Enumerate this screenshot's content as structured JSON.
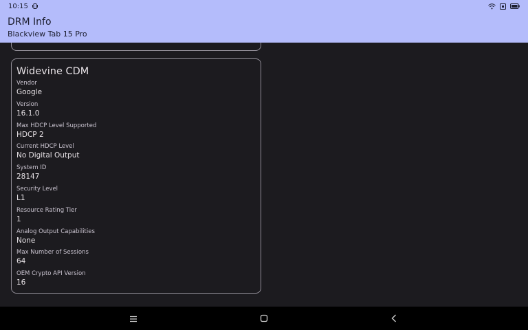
{
  "status_bar": {
    "time": "10:15",
    "icons": [
      "vibrate-icon",
      "wifi-icon",
      "sim-icon",
      "battery-icon"
    ]
  },
  "app_bar": {
    "title": "DRM Info",
    "subtitle": "Blackview Tab 15 Pro"
  },
  "card": {
    "title": "Widevine CDM",
    "fields": [
      {
        "label": "Vendor",
        "value": "Google"
      },
      {
        "label": "Version",
        "value": "16.1.0"
      },
      {
        "label": "Max HDCP Level Supported",
        "value": "HDCP 2"
      },
      {
        "label": "Current HDCP Level",
        "value": "No Digital Output"
      },
      {
        "label": "System ID",
        "value": "28147"
      },
      {
        "label": "Security Level",
        "value": "L1"
      },
      {
        "label": "Resource Rating Tier",
        "value": "1"
      },
      {
        "label": "Analog Output Capabilities",
        "value": "None"
      },
      {
        "label": "Max Number of Sessions",
        "value": "64"
      },
      {
        "label": "OEM Crypto API Version",
        "value": "16"
      }
    ]
  },
  "nav_bar": {
    "buttons": [
      "menu-icon",
      "home-icon",
      "back-icon"
    ]
  },
  "colors": {
    "app_bar_bg": "#b4bcfb",
    "background": "#1c1b1f",
    "card_border": "#938f99"
  }
}
